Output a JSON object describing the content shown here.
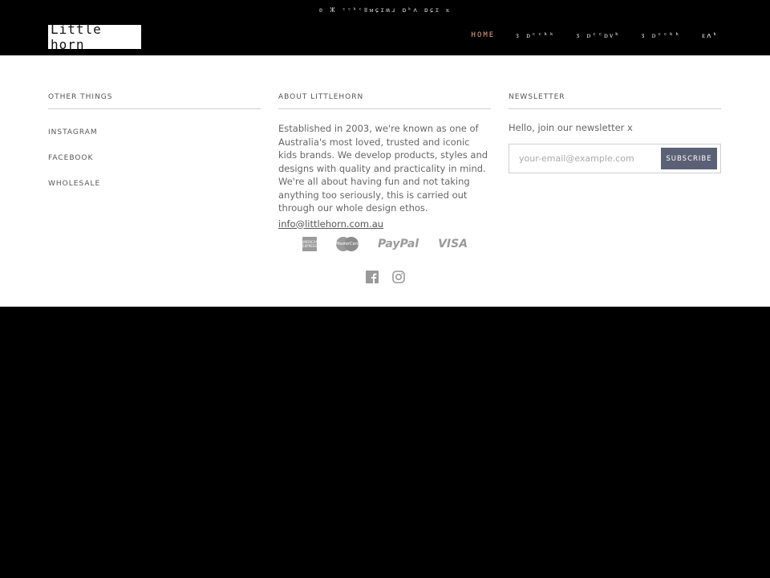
{
  "announcement": "ʚ ⵣ ᶜᶜᵏᶜʬᴍɕɪʍɹ ɒᵏʌ ɒɕɪ ᴋ",
  "logo": {
    "text": "Little horn"
  },
  "nav": [
    {
      "label": "HOME",
      "active": true
    },
    {
      "label": "ᴣ ᴅᶜᶜᵏᵏ",
      "active": false
    },
    {
      "label": "ᴣ ᴅᶜᶜᴅᴠᵏ",
      "active": false
    },
    {
      "label": "ᴣ ᴅᶜᶜᵏᵏ",
      "active": false
    },
    {
      "label": "ᴇʌᵏ",
      "active": false
    }
  ],
  "footer": {
    "other_things": {
      "heading": "OTHER THINGS",
      "links": [
        "INSTAGRAM",
        "FACEBOOK",
        "WHOLESALE"
      ]
    },
    "about": {
      "heading": "ABOUT LITTLEHORN",
      "body": "Established in 2003, we're known as one of Australia's most loved, trusted and iconic kids brands. We develop products, styles and designs with quality and practicality in mind. We're all about having fun and not taking anything too seriously, this is carried out through our whole design ethos.",
      "email": "info@littlehorn.com.au"
    },
    "newsletter": {
      "heading": "NEWSLETTER",
      "text": "Hello, join our newsletter x",
      "placeholder": "your-email@example.com",
      "button": "SUBSCRIBE"
    },
    "payments": {
      "amex": "AMERICAN EXPRESS",
      "mastercard": "MasterCard",
      "paypal": "PayPal",
      "visa": "VISA"
    }
  },
  "colors": {
    "nav_active": "#e8a37a",
    "subscribe_button": "#5b6175",
    "icon_gray": "#9a9a9a"
  }
}
